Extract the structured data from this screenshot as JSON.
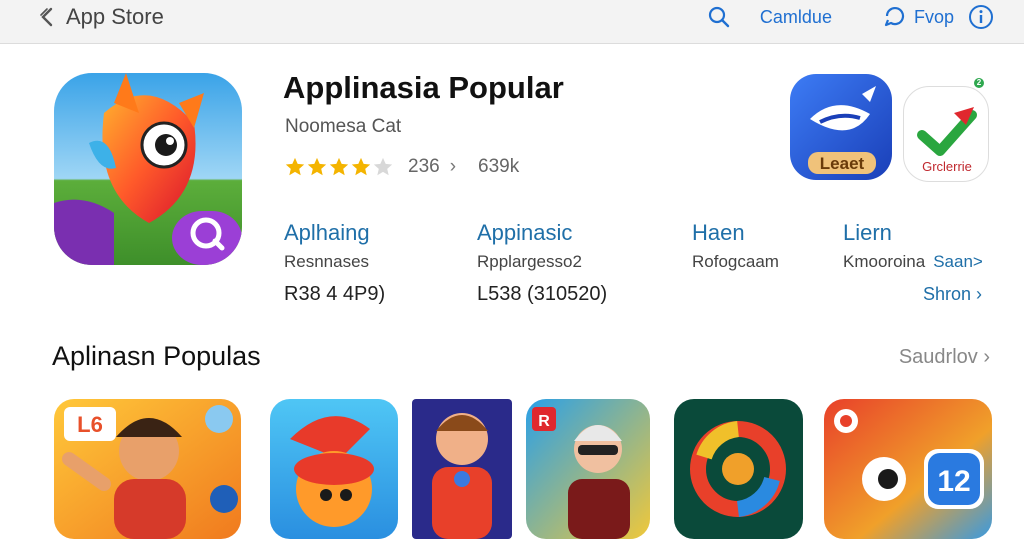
{
  "topbar": {
    "back_label": "App Store",
    "search_label": "Camldue",
    "account_label": "Fvop"
  },
  "featured": {
    "title": "Applinasia Popular",
    "subtitle": "Noomesa Cat",
    "rating": 4,
    "rating_count": "236",
    "downloads": "639k",
    "columns": [
      {
        "title": "Aplhaing",
        "sub": "Resnnases",
        "value": "R38 4 4P9)"
      },
      {
        "title": "Appinasic",
        "sub": "Rpplargesso2",
        "value": "L538 (310520)"
      },
      {
        "title": "Haen",
        "sub": "Rofogcaam"
      },
      {
        "title": "Liern",
        "sub": "Kmooroina",
        "sub_link": "Saan>",
        "link": "Shron"
      }
    ],
    "side_apps": [
      {
        "label": "Leaet"
      },
      {
        "label": "Grclerrie"
      }
    ],
    "badge": "2"
  },
  "popular": {
    "title": "Aplinasn Populas",
    "see_all": "Saudrlov",
    "tiles": [
      {
        "badge": "L6"
      },
      {
        "badge": ""
      },
      {
        "badge": ""
      },
      {
        "badge": "R"
      },
      {
        "badge": ""
      },
      {
        "badge": "12"
      }
    ]
  },
  "colors": {
    "accent": "#1f6fa8",
    "link_blue": "#1f6fd1",
    "star": "#f4b400"
  }
}
